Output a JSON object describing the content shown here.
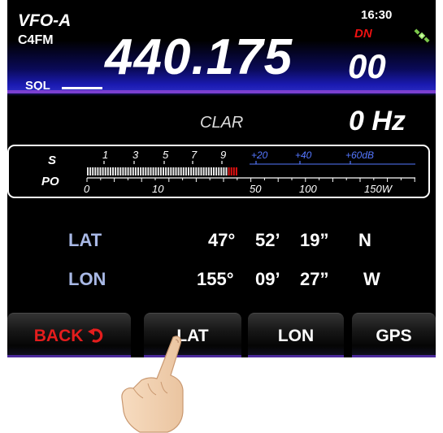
{
  "header": {
    "vfo": "VFO-A",
    "mode": "C4FM",
    "time": "16:30",
    "dn_badge": "DN",
    "frequency_main": "440.175",
    "frequency_sub": "00",
    "sql_label": "SQL",
    "sat_icon": "gps-satellite-icon"
  },
  "clar": {
    "label": "CLAR",
    "value": "0 Hz"
  },
  "meter": {
    "s_label": "S",
    "po_label": "PO",
    "s_scale": [
      "1",
      "3",
      "5",
      "7",
      "9"
    ],
    "s_plus_scale": [
      "+20",
      "+40",
      "+60dB"
    ],
    "po_scale": [
      "0",
      "10",
      "50",
      "100",
      "150W"
    ],
    "colors": {
      "s_scale": "#ffffff",
      "plus_scale": "#5577ff",
      "peak": "#e11111"
    }
  },
  "coordinates": {
    "lat": {
      "label": "LAT",
      "deg": "47°",
      "min": "52’",
      "sec": "19”",
      "dir": "N"
    },
    "lon": {
      "label": "LON",
      "deg": "155°",
      "min": "09’",
      "sec": "27”",
      "dir": "W"
    }
  },
  "softkeys": {
    "back": "BACK",
    "lat": "LAT",
    "lon": "LON",
    "gps": "GPS"
  },
  "colors": {
    "accent_purple": "#7b3fd0",
    "back_red": "#e41d1d",
    "coord_label": "#a9b9e6"
  }
}
